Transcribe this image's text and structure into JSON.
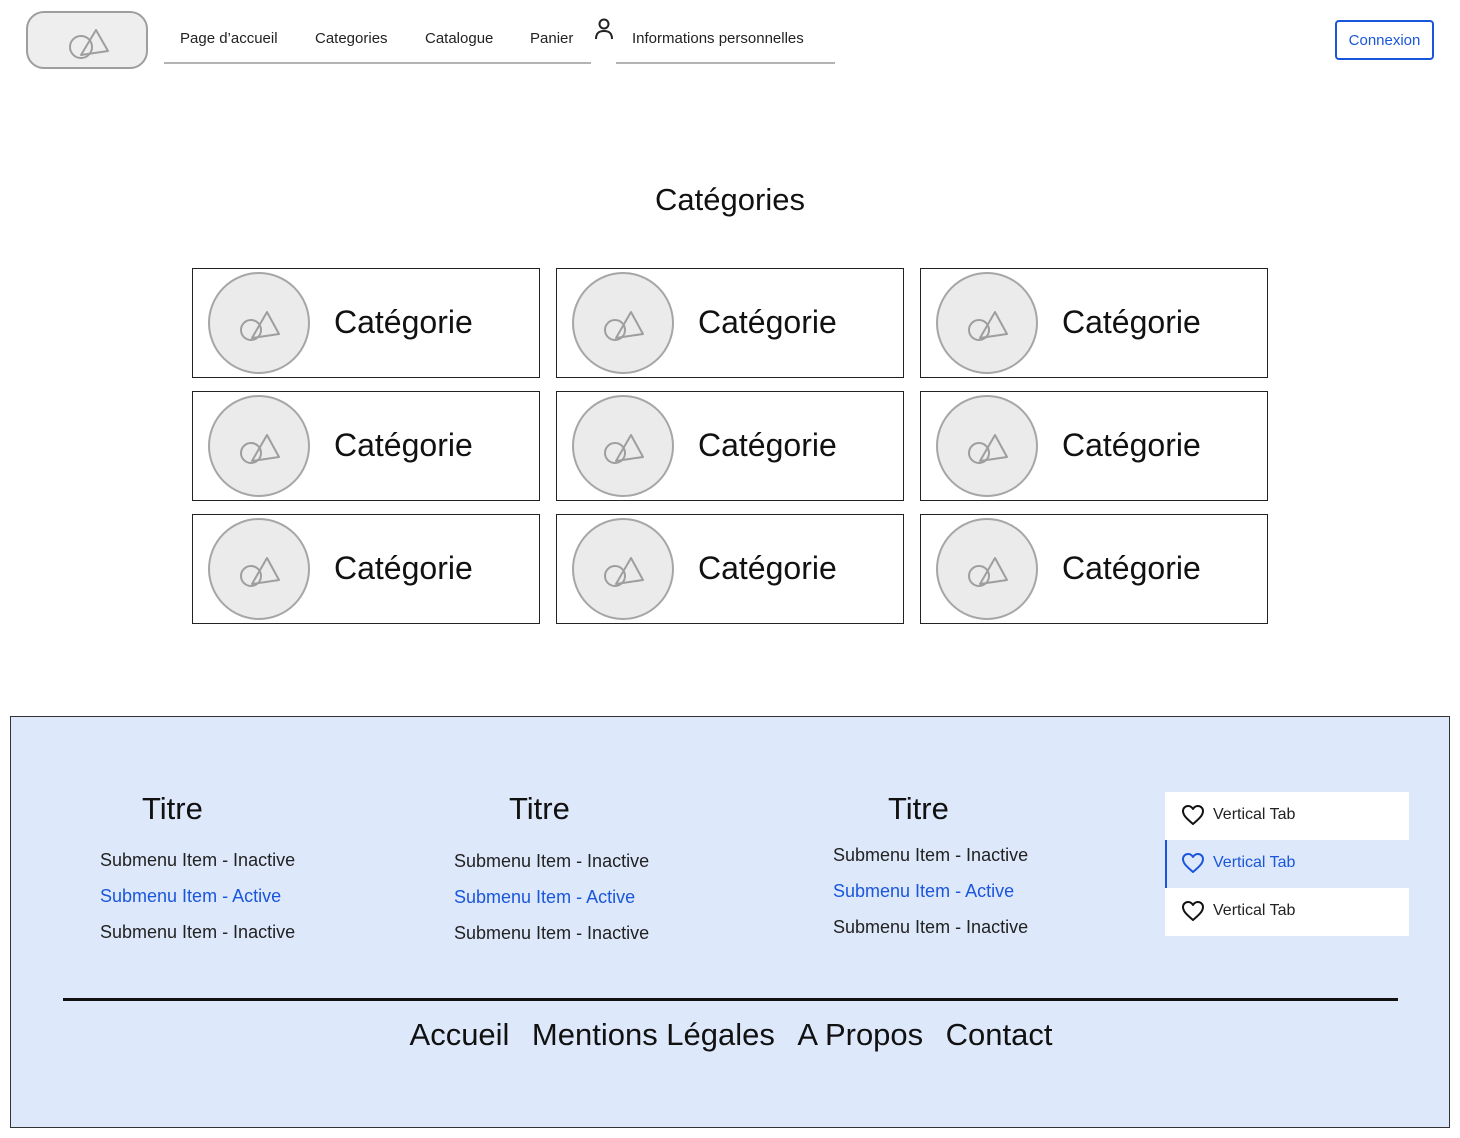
{
  "header": {
    "logo_icon": "image-placeholder-icon",
    "nav": [
      {
        "label": "Page d’accueil"
      },
      {
        "label": "Categories"
      },
      {
        "label": "Catalogue"
      },
      {
        "label": "Panier"
      },
      {
        "label": "Informations personnelles"
      }
    ],
    "user_icon": "user-icon",
    "login_label": "Connexion"
  },
  "main": {
    "title": "Catégories",
    "categories": [
      {
        "label": "Catégorie",
        "icon": "image-placeholder-icon"
      },
      {
        "label": "Catégorie",
        "icon": "image-placeholder-icon"
      },
      {
        "label": "Catégorie",
        "icon": "image-placeholder-icon"
      },
      {
        "label": "Catégorie",
        "icon": "image-placeholder-icon"
      },
      {
        "label": "Catégorie",
        "icon": "image-placeholder-icon"
      },
      {
        "label": "Catégorie",
        "icon": "image-placeholder-icon"
      },
      {
        "label": "Catégorie",
        "icon": "image-placeholder-icon"
      },
      {
        "label": "Catégorie",
        "icon": "image-placeholder-icon"
      },
      {
        "label": "Catégorie",
        "icon": "image-placeholder-icon"
      }
    ]
  },
  "footer": {
    "columns": [
      {
        "title": "Titre",
        "items": [
          {
            "label": "Submenu Item - Inactive",
            "active": false
          },
          {
            "label": "Submenu Item - Active",
            "active": true
          },
          {
            "label": "Submenu Item - Inactive",
            "active": false
          }
        ]
      },
      {
        "title": "Titre",
        "items": [
          {
            "label": "Submenu Item - Inactive",
            "active": false
          },
          {
            "label": "Submenu Item - Active",
            "active": true
          },
          {
            "label": "Submenu Item - Inactive",
            "active": false
          }
        ]
      },
      {
        "title": "Titre",
        "items": [
          {
            "label": "Submenu Item - Inactive",
            "active": false
          },
          {
            "label": "Submenu Item - Active",
            "active": true
          },
          {
            "label": "Submenu Item - Inactive",
            "active": false
          }
        ]
      }
    ],
    "vertical_tabs": [
      {
        "label": "Vertical Tab",
        "icon": "heart-icon",
        "active": false
      },
      {
        "label": "Vertical Tab",
        "icon": "heart-icon",
        "active": true
      },
      {
        "label": "Vertical Tab",
        "icon": "heart-icon",
        "active": false
      }
    ],
    "links": [
      {
        "label": "Accueil"
      },
      {
        "label": "Mentions Légales"
      },
      {
        "label": "A Propos"
      },
      {
        "label": "Contact"
      }
    ]
  },
  "colors": {
    "accent": "#1a56db",
    "footer_background": "#dde8fb",
    "placeholder_fill": "#ebebeb",
    "placeholder_stroke": "#a6a6a6"
  }
}
